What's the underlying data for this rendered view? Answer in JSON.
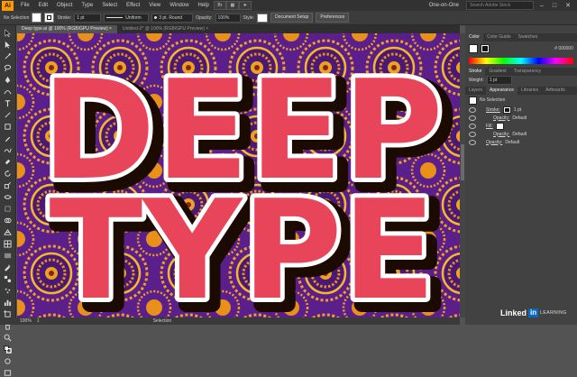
{
  "menubar": {
    "app_logo": "Ai",
    "items": [
      "File",
      "Edit",
      "Object",
      "Type",
      "Select",
      "Effect",
      "View",
      "Window",
      "Help"
    ],
    "workspace": "One-on-One",
    "search_placeholder": "Search Adobe Stock"
  },
  "controlbar": {
    "selection_label": "No Selection",
    "stroke_label": "Stroke:",
    "stroke_weight": "1 pt",
    "profile": "Uniform",
    "brush": "3 pt. Round",
    "opacity_label": "Opacity:",
    "opacity_value": "100%",
    "style_label": "Style:",
    "doc_setup_button": "Document Setup",
    "preferences_button": "Preferences"
  },
  "tabs": {
    "doc_tabs": [
      "Deep type.ai @ 100% (RGB/GPU Preview)",
      "Untitled-2* @ 100% (RGB/GPU Preview)"
    ]
  },
  "panels": {
    "color_tabs": [
      "Color",
      "Color Guide",
      "Swatches"
    ],
    "color_hex": "000000",
    "stroke_tabs": [
      "Stroke",
      "Gradient",
      "Transparency"
    ],
    "weight_label": "Weight:",
    "weight_value": "1 pt",
    "appearance_tabs": [
      "Layers",
      "Appearance",
      "Libraries",
      "Artboards"
    ],
    "no_selection": "No Selection",
    "stroke_row_label": "Stroke:",
    "stroke_row_value": "1 pt",
    "opacity_row_label": "Opacity:",
    "opacity_row_value": "Default",
    "fill_row_label": "Fill:",
    "fill_opacity_label": "Opacity:",
    "fill_opacity_value": "Default",
    "layer_opacity_label": "Opacity:",
    "layer_opacity_value": "Default"
  },
  "canvas": {
    "line1": "DEEP",
    "line2": "TYPE",
    "colors": {
      "fill": "#e8445a",
      "outline": "#ffffff",
      "pattern_bg": "#5a1f8a",
      "pattern_gold": "#f0a020"
    }
  },
  "statusbar": {
    "zoom": "100%",
    "artboard": "1",
    "tool": "Selection"
  },
  "watermark": {
    "linked": "Linked",
    "in": "in",
    "learning": "LEARNING"
  }
}
